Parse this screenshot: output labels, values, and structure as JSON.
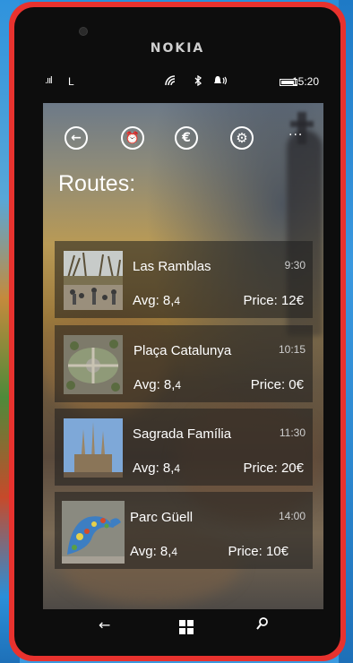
{
  "device": {
    "brand": "NOKIA"
  },
  "status_bar": {
    "carrier": "L",
    "time": "15:20"
  },
  "toolbar": {
    "back_glyph": "←",
    "alarm_glyph": "⏰",
    "euro_glyph": "€",
    "settings_glyph": "⚙",
    "more_glyph": "..."
  },
  "page": {
    "title": "Routes:"
  },
  "routes": [
    {
      "name": "Las Ramblas",
      "time": "9:30",
      "avg_label": "Avg: 8,",
      "avg_decimal": "4",
      "price": "Price: 12€"
    },
    {
      "name": "Plaça Catalunya",
      "time": "10:15",
      "avg_label": "Avg: 8,",
      "avg_decimal": "4",
      "price": "Price: 0€"
    },
    {
      "name": "Sagrada Família",
      "time": "11:30",
      "avg_label": "Avg: 8,",
      "avg_decimal": "4",
      "price": "Price: 20€"
    },
    {
      "name": "Parc Güell",
      "time": "14:00",
      "avg_label": "Avg: 8,",
      "avg_decimal": "4",
      "price": "Price: 10€"
    }
  ],
  "nav": {
    "back_glyph": "←",
    "search_glyph": "⚲"
  },
  "colors": {
    "phone_body": "#e8322e",
    "card_bg": "rgba(30,30,30,0.55)"
  }
}
